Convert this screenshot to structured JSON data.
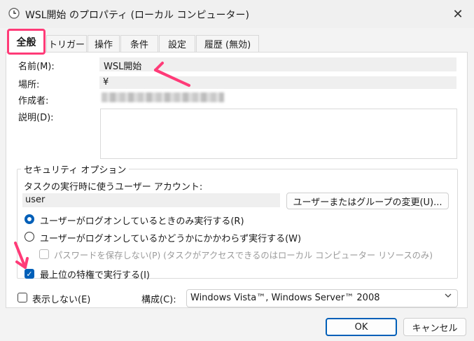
{
  "window": {
    "title": "WSL開始 のプロパティ (ローカル コンピューター)",
    "title_icon": "clock-icon",
    "close_glyph": "✕"
  },
  "tabs": [
    {
      "label": "全般",
      "active": true
    },
    {
      "label": "トリガー"
    },
    {
      "label": "操作"
    },
    {
      "label": "条件"
    },
    {
      "label": "設定"
    },
    {
      "label": "履歴 (無効)"
    }
  ],
  "general": {
    "name_label": "名前(M):",
    "name_value": "WSL開始",
    "location_label": "場所:",
    "location_value": "¥",
    "author_label": "作成者:",
    "description_label": "説明(D):",
    "description_value": ""
  },
  "security": {
    "group_title": "セキュリティ オプション",
    "account_label": "タスクの実行時に使うユーザー アカウント:",
    "user_value": "user",
    "change_button": "ユーザーまたはグループの変更(U)...",
    "radio_logged_on": "ユーザーがログオンしているときのみ実行する(R)",
    "radio_whether": "ユーザーがログオンしているかどうかにかかわらず実行する(W)",
    "no_store_password": "パスワードを保存しない(P) (タスクがアクセスできるのはローカル コンピューター リソースのみ)",
    "highest_privileges": "最上位の特権で実行する(I)"
  },
  "bottom": {
    "hidden_label": "表示しない(E)",
    "configure_label": "構成(C):",
    "configure_value": "Windows Vista™, Windows Server™ 2008",
    "ok": "OK",
    "cancel": "キャンセル"
  },
  "colors": {
    "accent": "#005fb8",
    "highlight": "#ff3b78"
  }
}
